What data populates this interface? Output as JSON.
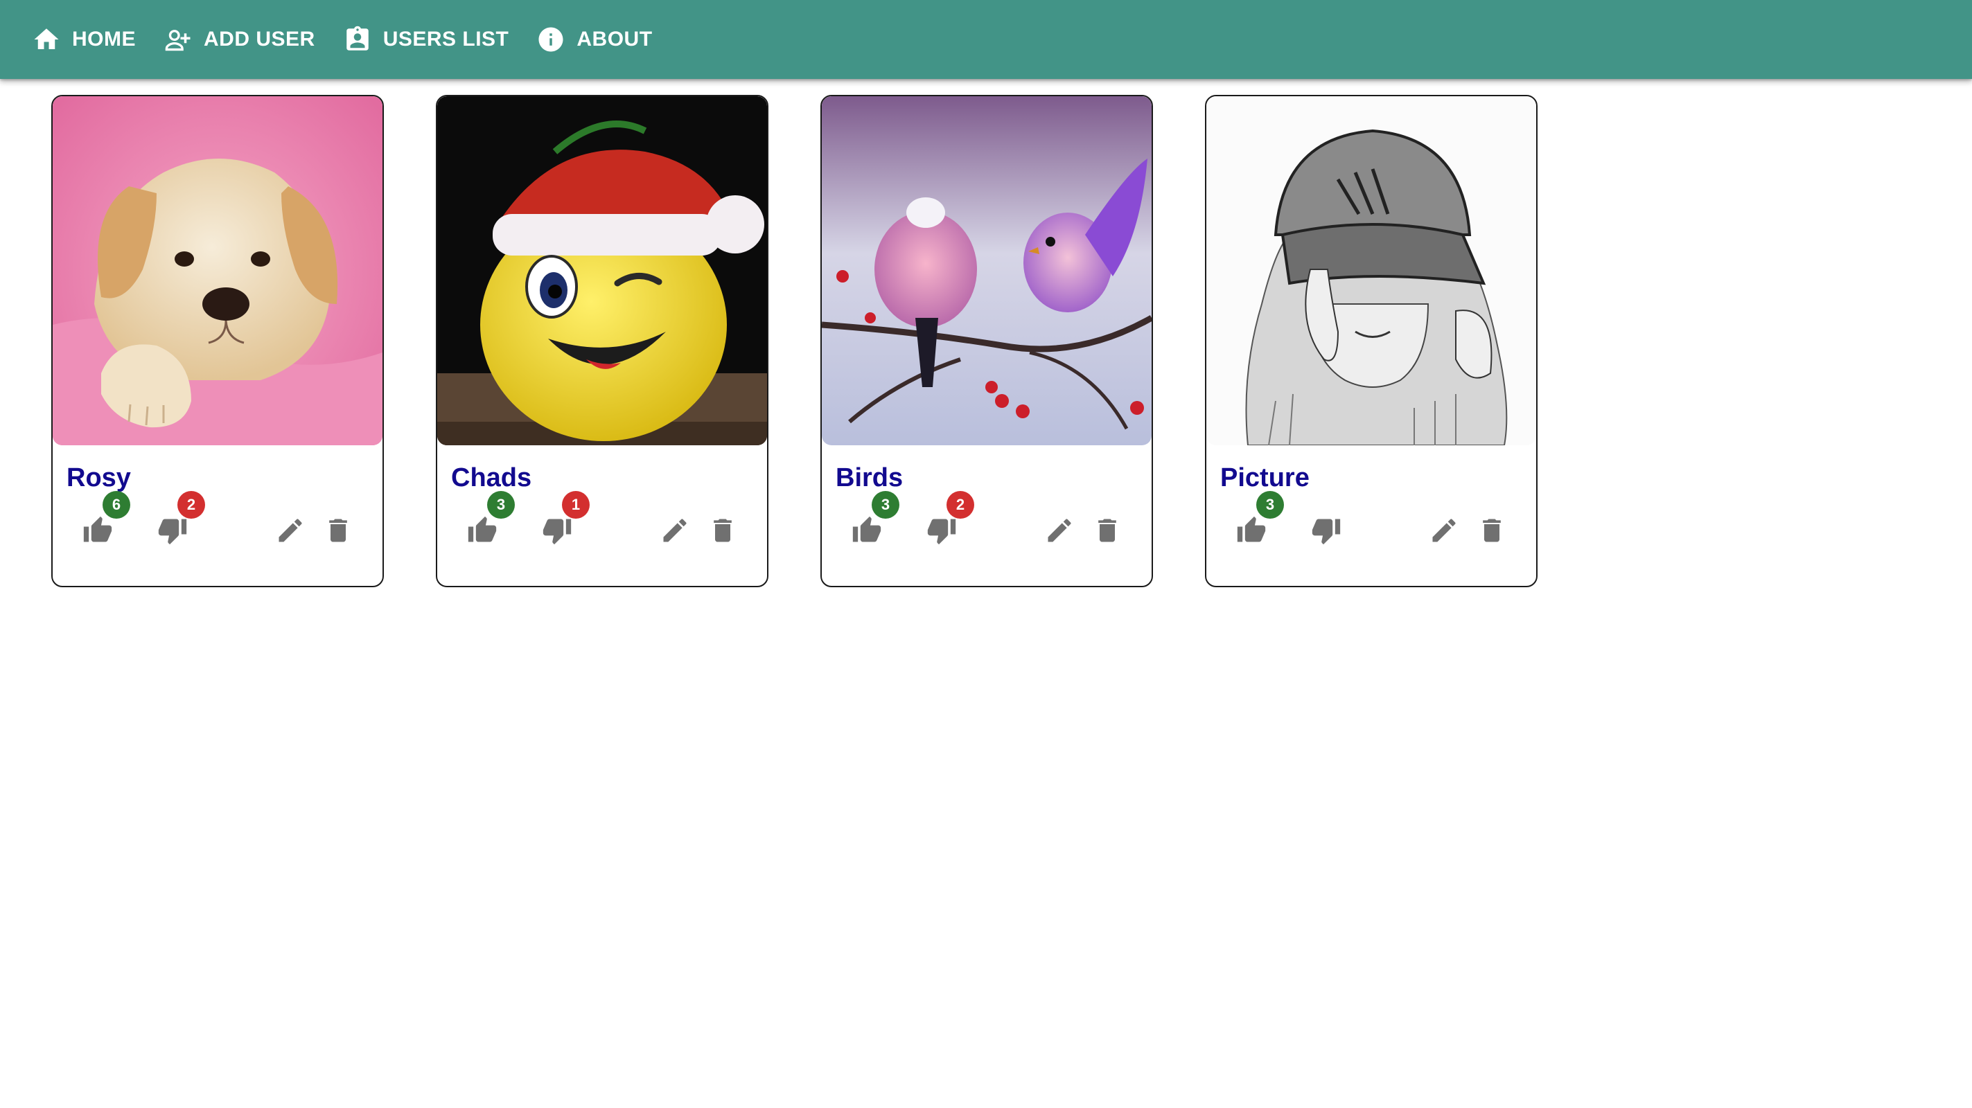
{
  "nav": {
    "items": [
      {
        "label": "HOME",
        "icon": "home-icon"
      },
      {
        "label": "ADD USER",
        "icon": "person-add-icon"
      },
      {
        "label": "USERS LIST",
        "icon": "contact-card-icon"
      },
      {
        "label": "ABOUT",
        "icon": "info-icon"
      }
    ]
  },
  "colors": {
    "appbar": "#429487",
    "title": "#120a8f",
    "icon_gray": "#707070",
    "badge_like": "#2e7d32",
    "badge_dislike": "#d32f2f"
  },
  "cards": [
    {
      "name": "Rosy",
      "image": "puppy on pink fur",
      "likes": "6",
      "dislikes": "2"
    },
    {
      "name": "Chads",
      "image": "yellow smiley ball with santa hat",
      "likes": "3",
      "dislikes": "1"
    },
    {
      "name": "Birds",
      "image": "two pink birds on winter branch",
      "likes": "3",
      "dislikes": "2"
    },
    {
      "name": "Picture",
      "image": "pencil sketch of girl in adidas cap",
      "likes": "3",
      "dislikes": ""
    }
  ]
}
